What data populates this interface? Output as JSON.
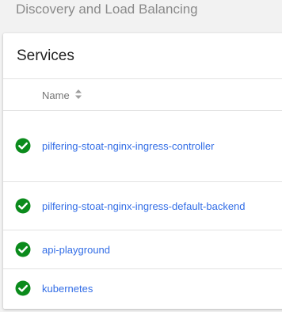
{
  "page": {
    "section_title": "Discovery and Load Balancing"
  },
  "services": {
    "title": "Services",
    "column_name": "Name",
    "rows": [
      {
        "name": "pilfering-stoat-nginx-ingress-controller",
        "status": "ok"
      },
      {
        "name": "pilfering-stoat-nginx-ingress-default-backend",
        "status": "ok"
      },
      {
        "name": "api-playground",
        "status": "ok"
      },
      {
        "name": "kubernetes",
        "status": "ok"
      }
    ]
  },
  "icons": {
    "status": "check-circle-icon",
    "sort": "sort-icon"
  },
  "colors": {
    "link": "#326de6",
    "success": "#0b8b1c",
    "muted_text": "#8a8a8a"
  }
}
